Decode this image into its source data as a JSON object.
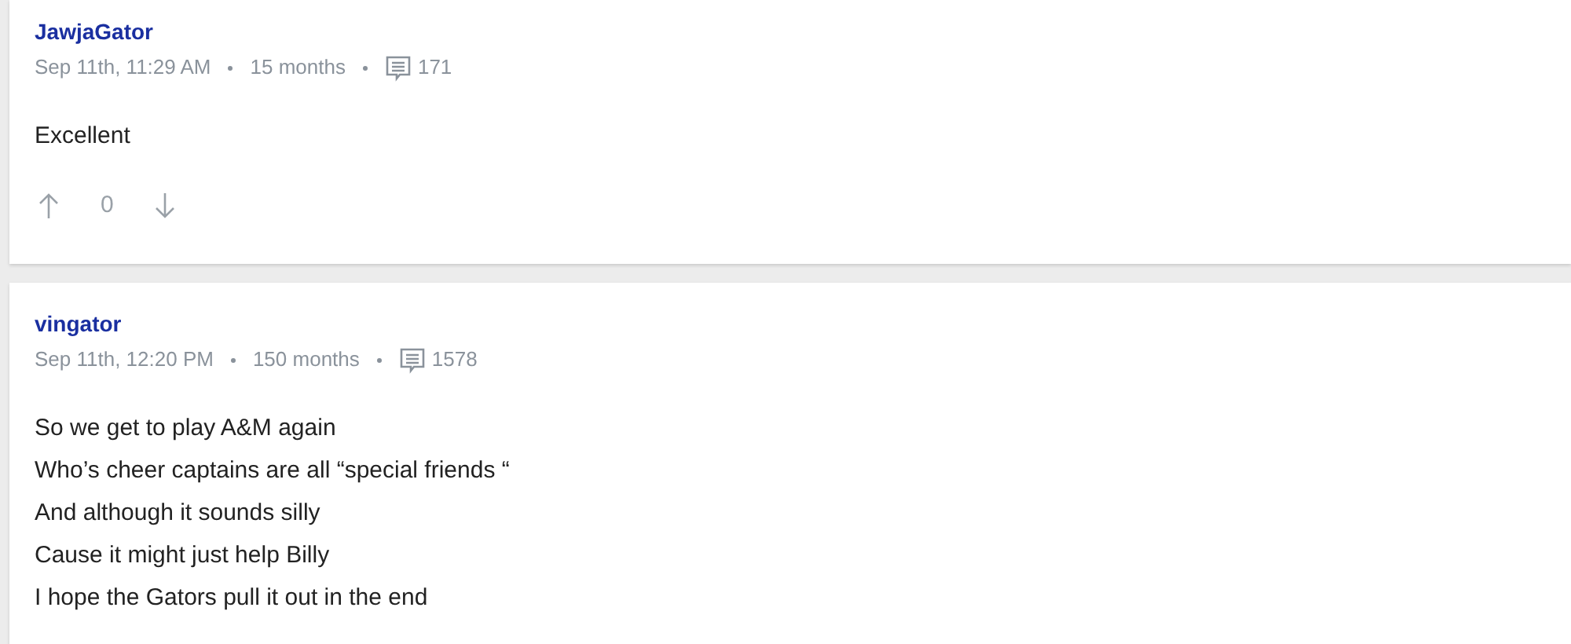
{
  "posts": [
    {
      "author": "JawjaGator",
      "date": "Sep 11th, 11:29 AM",
      "tenure": "15 months",
      "post_count": "171",
      "lines": [
        "Excellent"
      ],
      "votes": {
        "score": "0"
      }
    },
    {
      "author": "vingator",
      "date": "Sep 11th, 12:20 PM",
      "tenure": "150 months",
      "post_count": "1578",
      "lines": [
        "So we get to play A&M again",
        "Who’s cheer captains are all “special friends “",
        "And although it sounds silly",
        "Cause it might just help Billy",
        "I hope the Gators pull it out in the end"
      ]
    }
  ]
}
